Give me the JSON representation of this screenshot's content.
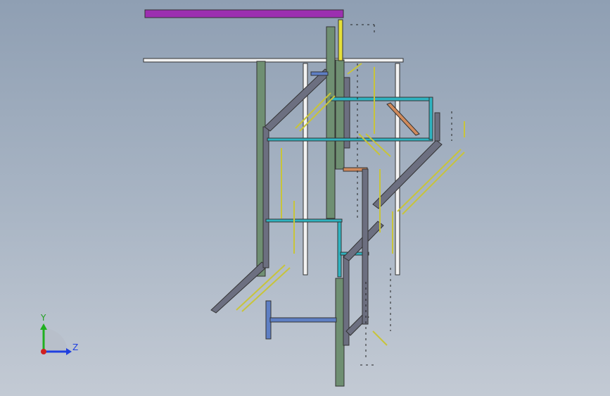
{
  "colors": {
    "background_top": "#8f9fb3",
    "background_bottom": "#c3cad4",
    "member_green": "#6f8f72",
    "member_grey": "#6c6f80",
    "member_cyan": "#2fb3c0",
    "member_magenta": "#9c2fb0",
    "member_white": "#f2f2f2",
    "member_yellow": "#e5e03a",
    "member_orange": "#d08a5c",
    "member_blue": "#5e7fc4",
    "axis_x": "#d02020",
    "axis_y": "#20b020",
    "axis_z": "#2040e0"
  },
  "triad": {
    "y_label": "Y",
    "z_label": "Z"
  },
  "model": {
    "name_icon": "structural-frame-model"
  }
}
